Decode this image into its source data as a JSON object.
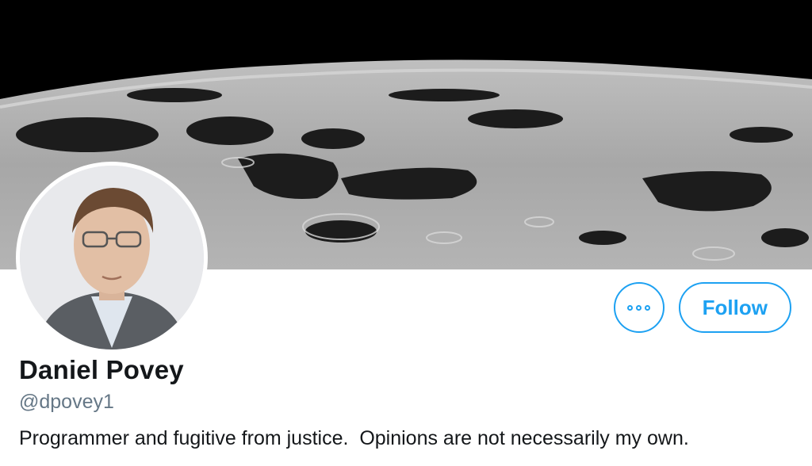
{
  "profile": {
    "name": "Daniel Povey",
    "handle": "@dpovey1",
    "bio": "Programmer and fugitive from justice.  Opinions are not necessarily my own."
  },
  "actions": {
    "more_icon": "more-horizontal-icon",
    "follow_label": "Follow"
  },
  "colors": {
    "accent": "#1da1f2",
    "name_text": "#14171a",
    "handle_text": "#657786"
  }
}
